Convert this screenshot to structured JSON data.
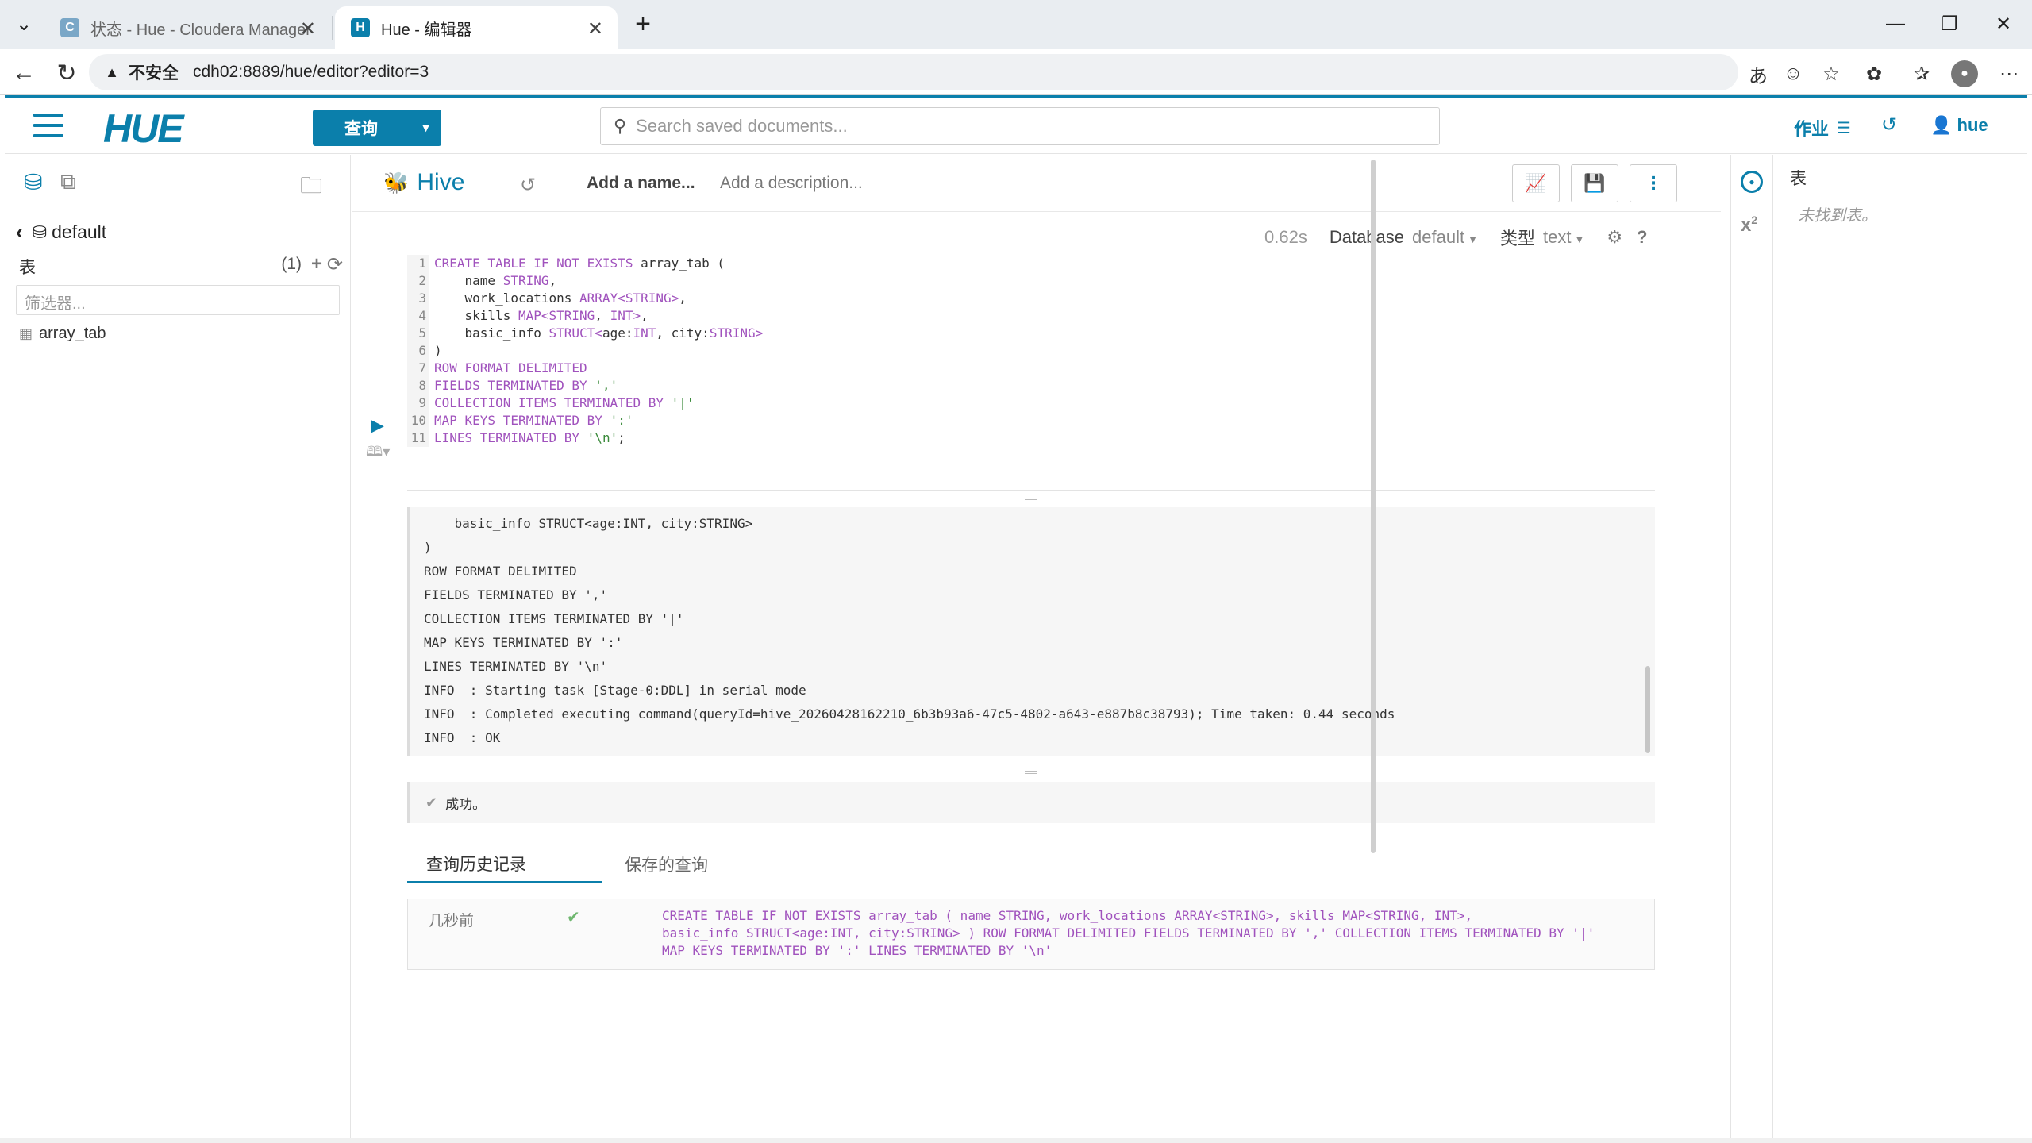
{
  "browser": {
    "tabs": [
      {
        "title": "状态 - Hue - Cloudera Manager",
        "favicon": "C",
        "active": false
      },
      {
        "title": "Hue - 编辑器",
        "favicon": "H",
        "active": true
      }
    ],
    "new_tab": "+",
    "window_controls": {
      "minimize": "—",
      "restore": "❐",
      "close": "✕"
    },
    "address": {
      "insecure_label": "不安全",
      "url": "cdh02:8889/hue/editor?editor=3"
    }
  },
  "nav": {
    "logo": "HUE",
    "query_button": "查询",
    "search_placeholder": "Search saved documents...",
    "jobs_label": "作业",
    "user": "hue"
  },
  "left": {
    "database": "default",
    "tables_label": "表",
    "tables_count": "(1)",
    "filter_placeholder": "筛选器...",
    "tables": [
      "array_tab"
    ]
  },
  "editor": {
    "engine": "Hive",
    "name_placeholder": "Add a name...",
    "desc_placeholder": "Add a description...",
    "duration": "0.62s",
    "database_label": "Database",
    "database_value": "default",
    "type_label": "类型",
    "type_value": "text",
    "line_numbers": [
      "1",
      "2",
      "3",
      "4",
      "5",
      "6",
      "7",
      "8",
      "9",
      "10",
      "11"
    ]
  },
  "log": {
    "lines": [
      "    basic_info STRUCT<age:INT, city:STRING>",
      ")",
      "ROW FORMAT DELIMITED",
      "FIELDS TERMINATED BY ','",
      "COLLECTION ITEMS TERMINATED BY '|'",
      "MAP KEYS TERMINATED BY ':'",
      "LINES TERMINATED BY '\\n'",
      "INFO  : Starting task [Stage-0:DDL] in serial mode",
      "INFO  : Completed executing command(queryId=hive_20260428162210_6b3b93a6-47c5-4802-a643-e887b8c38793); Time taken: 0.44 seconds",
      "INFO  : OK"
    ]
  },
  "result": {
    "status": "成功。"
  },
  "history": {
    "tabs": [
      "查询历史记录",
      "保存的查询"
    ],
    "entries": [
      {
        "time": "几秒前",
        "query_line1": "CREATE TABLE IF NOT EXISTS array_tab ( name STRING, work_locations ARRAY<STRING>, skills MAP<STRING, INT>,",
        "query_line2": "basic_info STRUCT<age:INT, city:STRING> ) ROW FORMAT DELIMITED FIELDS TERMINATED BY ',' COLLECTION ITEMS TERMINATED BY '|'",
        "query_line3": "MAP KEYS TERMINATED BY ':' LINES TERMINATED BY '\\n'"
      }
    ]
  },
  "right": {
    "title": "表",
    "empty": "未找到表。"
  },
  "colors": {
    "accent": "#0b7fab",
    "keyword": "#a052bd",
    "string": "#3a8a3a",
    "success": "#6fb76f"
  }
}
